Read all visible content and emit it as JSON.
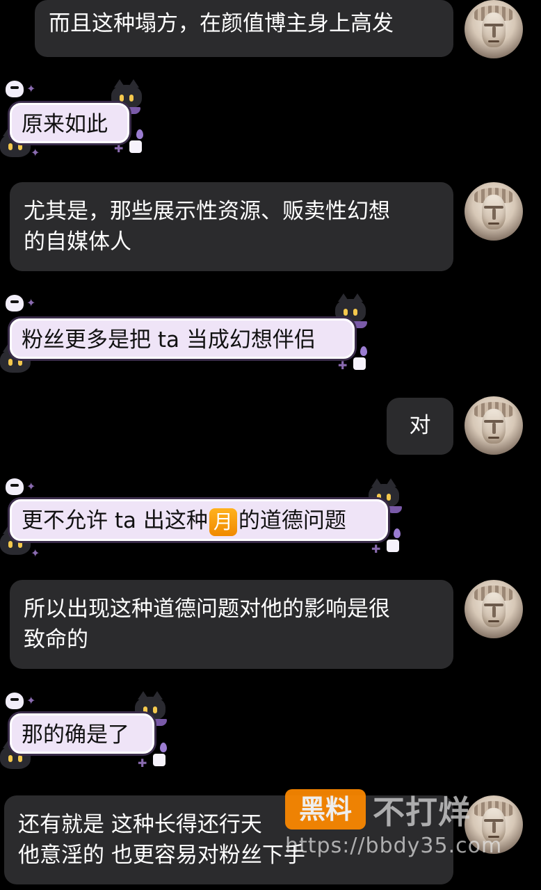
{
  "messages": [
    {
      "side": "right",
      "text": "而且这种塌方，在颜值博主身上高发"
    },
    {
      "side": "left",
      "text": "原来如此"
    },
    {
      "side": "right",
      "line1": "尤其是，那些展示性资源、贩卖性幻想",
      "line2": "的自媒体人"
    },
    {
      "side": "left",
      "text": "粉丝更多是把 ta 当成幻想伴侣"
    },
    {
      "side": "right",
      "text": "对"
    },
    {
      "side": "left",
      "text_before": "更不允许 ta 出这种",
      "emoji": "月",
      "text_after": "的道德问题"
    },
    {
      "side": "right",
      "line1": "所以出现这种道德问题对他的影响是很",
      "line2": "致命的"
    },
    {
      "side": "left",
      "text": "那的确是了"
    },
    {
      "side": "right",
      "line1": "还有就是 这种长得还行天",
      "line2": "他意淫的 也更容易对粉丝下手"
    }
  ],
  "watermark": {
    "badge": "黑料",
    "text": "不打烊",
    "url": "https://bbdy35.com"
  },
  "icons": {
    "avatar": "statue-avatar-icon",
    "decor": [
      "ghost-icon",
      "cat-icon",
      "candle-icon",
      "sparkle-icon",
      "bat-icon"
    ]
  }
}
